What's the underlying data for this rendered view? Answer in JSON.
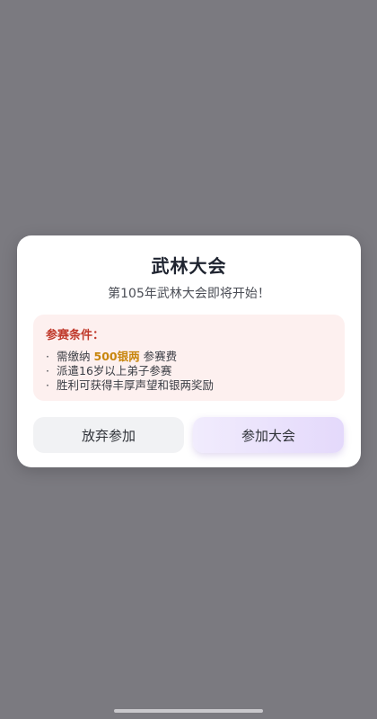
{
  "dialog": {
    "title": "武林大会",
    "subtitle": "第105年武林大会即将开始！",
    "conditions": {
      "heading": "参赛条件：",
      "item1": {
        "prefix": "需缴纳",
        "highlight": "500银两",
        "suffix": "参赛费"
      },
      "item2": "派遣16岁以上弟子参赛",
      "item3": "胜利可获得丰厚声望和银两奖励"
    },
    "buttons": {
      "cancel": "放弃参加",
      "join": "参加大会"
    }
  },
  "colors": {
    "overlay": "#7b7a80",
    "highlight": "#c8860d",
    "condition_heading": "#c0392b",
    "join_button": "#e4d9fb"
  }
}
